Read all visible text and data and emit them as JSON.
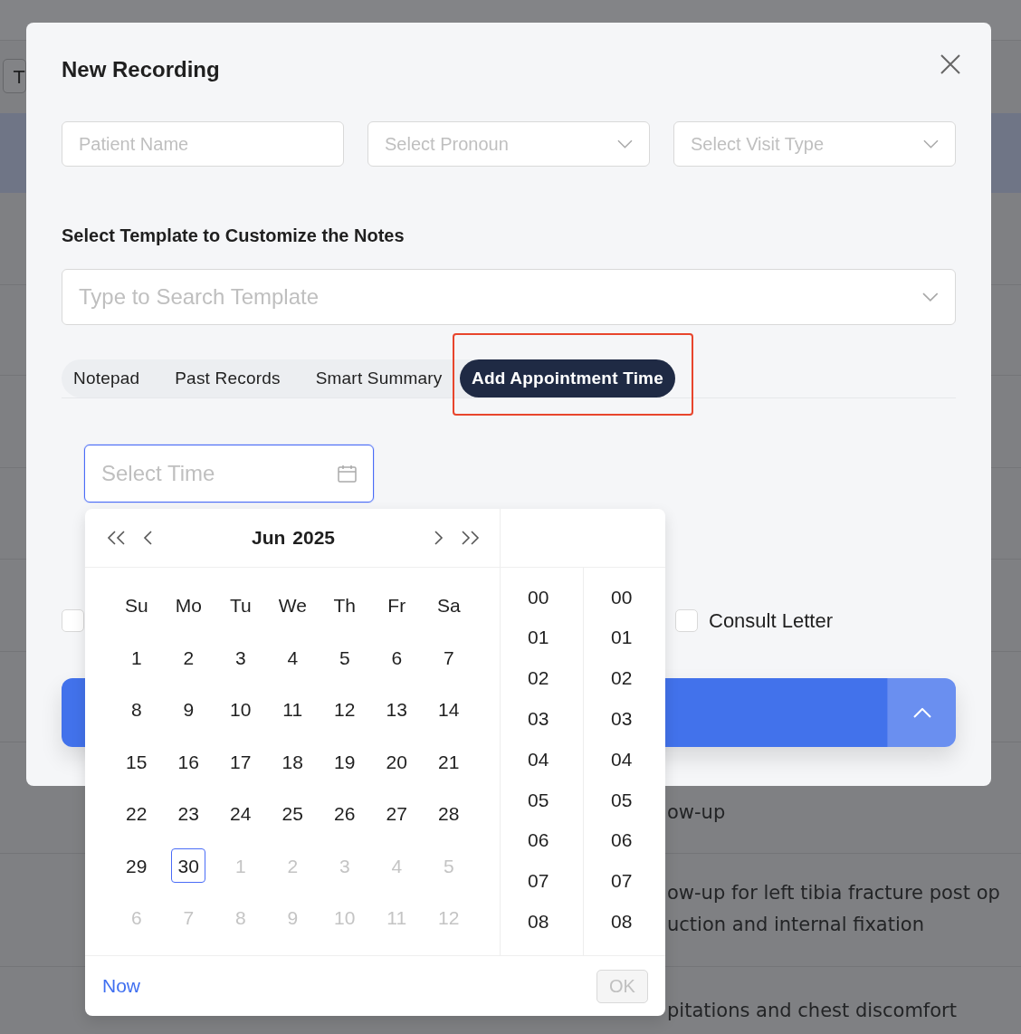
{
  "background": {
    "toolbar_button": "T",
    "rows": [
      {
        "lines": []
      },
      {
        "lines": []
      },
      {
        "lines": []
      },
      {
        "lines": []
      },
      {
        "lines": []
      },
      {
        "lines": []
      },
      {
        "lines": [
          "ow-up"
        ]
      },
      {
        "lines": [
          "ow-up for left tibia fracture post op",
          "uction and internal fixation"
        ]
      },
      {
        "lines": [
          "pitations and chest discomfort"
        ]
      }
    ]
  },
  "dialog": {
    "title": "New Recording",
    "fields": [
      {
        "kind": "input",
        "placeholder": "Patient Name"
      },
      {
        "kind": "select",
        "placeholder": "Select Pronoun"
      },
      {
        "kind": "select",
        "placeholder": "Select Visit Type"
      }
    ],
    "template_heading": "Select Template to Customize the Notes",
    "template_search": {
      "placeholder": "Type to Search Template"
    },
    "tabs": [
      {
        "label": "Notepad",
        "selected": false,
        "highlighted": false
      },
      {
        "label": "Past Records",
        "selected": false,
        "highlighted": false
      },
      {
        "label": "Smart Summary",
        "selected": false,
        "highlighted": false
      },
      {
        "label": "Add Appointment Time",
        "selected": true,
        "highlighted": true
      }
    ],
    "time_field": {
      "placeholder": "Select Time",
      "focused": true
    },
    "checkboxes": [
      {
        "checked": false
      },
      {
        "label": "Consult Letter",
        "checked": false
      }
    ]
  },
  "date_picker": {
    "month": "Jun",
    "year": "2025",
    "weekdays": [
      "Su",
      "Mo",
      "Tu",
      "We",
      "Th",
      "Fr",
      "Sa"
    ],
    "days": [
      {
        "day": "1",
        "in_month": true,
        "selected": false
      },
      {
        "day": "2",
        "in_month": true,
        "selected": false
      },
      {
        "day": "3",
        "in_month": true,
        "selected": false
      },
      {
        "day": "4",
        "in_month": true,
        "selected": false
      },
      {
        "day": "5",
        "in_month": true,
        "selected": false
      },
      {
        "day": "6",
        "in_month": true,
        "selected": false
      },
      {
        "day": "7",
        "in_month": true,
        "selected": false
      },
      {
        "day": "8",
        "in_month": true,
        "selected": false
      },
      {
        "day": "9",
        "in_month": true,
        "selected": false
      },
      {
        "day": "10",
        "in_month": true,
        "selected": false
      },
      {
        "day": "11",
        "in_month": true,
        "selected": false
      },
      {
        "day": "12",
        "in_month": true,
        "selected": false
      },
      {
        "day": "13",
        "in_month": true,
        "selected": false
      },
      {
        "day": "14",
        "in_month": true,
        "selected": false
      },
      {
        "day": "15",
        "in_month": true,
        "selected": false
      },
      {
        "day": "16",
        "in_month": true,
        "selected": false
      },
      {
        "day": "17",
        "in_month": true,
        "selected": false
      },
      {
        "day": "18",
        "in_month": true,
        "selected": false
      },
      {
        "day": "19",
        "in_month": true,
        "selected": false
      },
      {
        "day": "20",
        "in_month": true,
        "selected": false
      },
      {
        "day": "21",
        "in_month": true,
        "selected": false
      },
      {
        "day": "22",
        "in_month": true,
        "selected": false
      },
      {
        "day": "23",
        "in_month": true,
        "selected": false
      },
      {
        "day": "24",
        "in_month": true,
        "selected": false
      },
      {
        "day": "25",
        "in_month": true,
        "selected": false
      },
      {
        "day": "26",
        "in_month": true,
        "selected": false
      },
      {
        "day": "27",
        "in_month": true,
        "selected": false
      },
      {
        "day": "28",
        "in_month": true,
        "selected": false
      },
      {
        "day": "29",
        "in_month": true,
        "selected": false
      },
      {
        "day": "30",
        "in_month": true,
        "selected": true
      },
      {
        "day": "1",
        "in_month": false,
        "selected": false
      },
      {
        "day": "2",
        "in_month": false,
        "selected": false
      },
      {
        "day": "3",
        "in_month": false,
        "selected": false
      },
      {
        "day": "4",
        "in_month": false,
        "selected": false
      },
      {
        "day": "5",
        "in_month": false,
        "selected": false
      },
      {
        "day": "6",
        "in_month": false,
        "selected": false
      },
      {
        "day": "7",
        "in_month": false,
        "selected": false
      },
      {
        "day": "8",
        "in_month": false,
        "selected": false
      },
      {
        "day": "9",
        "in_month": false,
        "selected": false
      },
      {
        "day": "10",
        "in_month": false,
        "selected": false
      },
      {
        "day": "11",
        "in_month": false,
        "selected": false
      },
      {
        "day": "12",
        "in_month": false,
        "selected": false
      }
    ],
    "hours": [
      "00",
      "01",
      "02",
      "03",
      "04",
      "05",
      "06",
      "07",
      "08"
    ],
    "minutes": [
      "00",
      "01",
      "02",
      "03",
      "04",
      "05",
      "06",
      "07",
      "08"
    ],
    "now_link": "Now",
    "ok_button": {
      "label": "OK",
      "disabled": true
    }
  }
}
